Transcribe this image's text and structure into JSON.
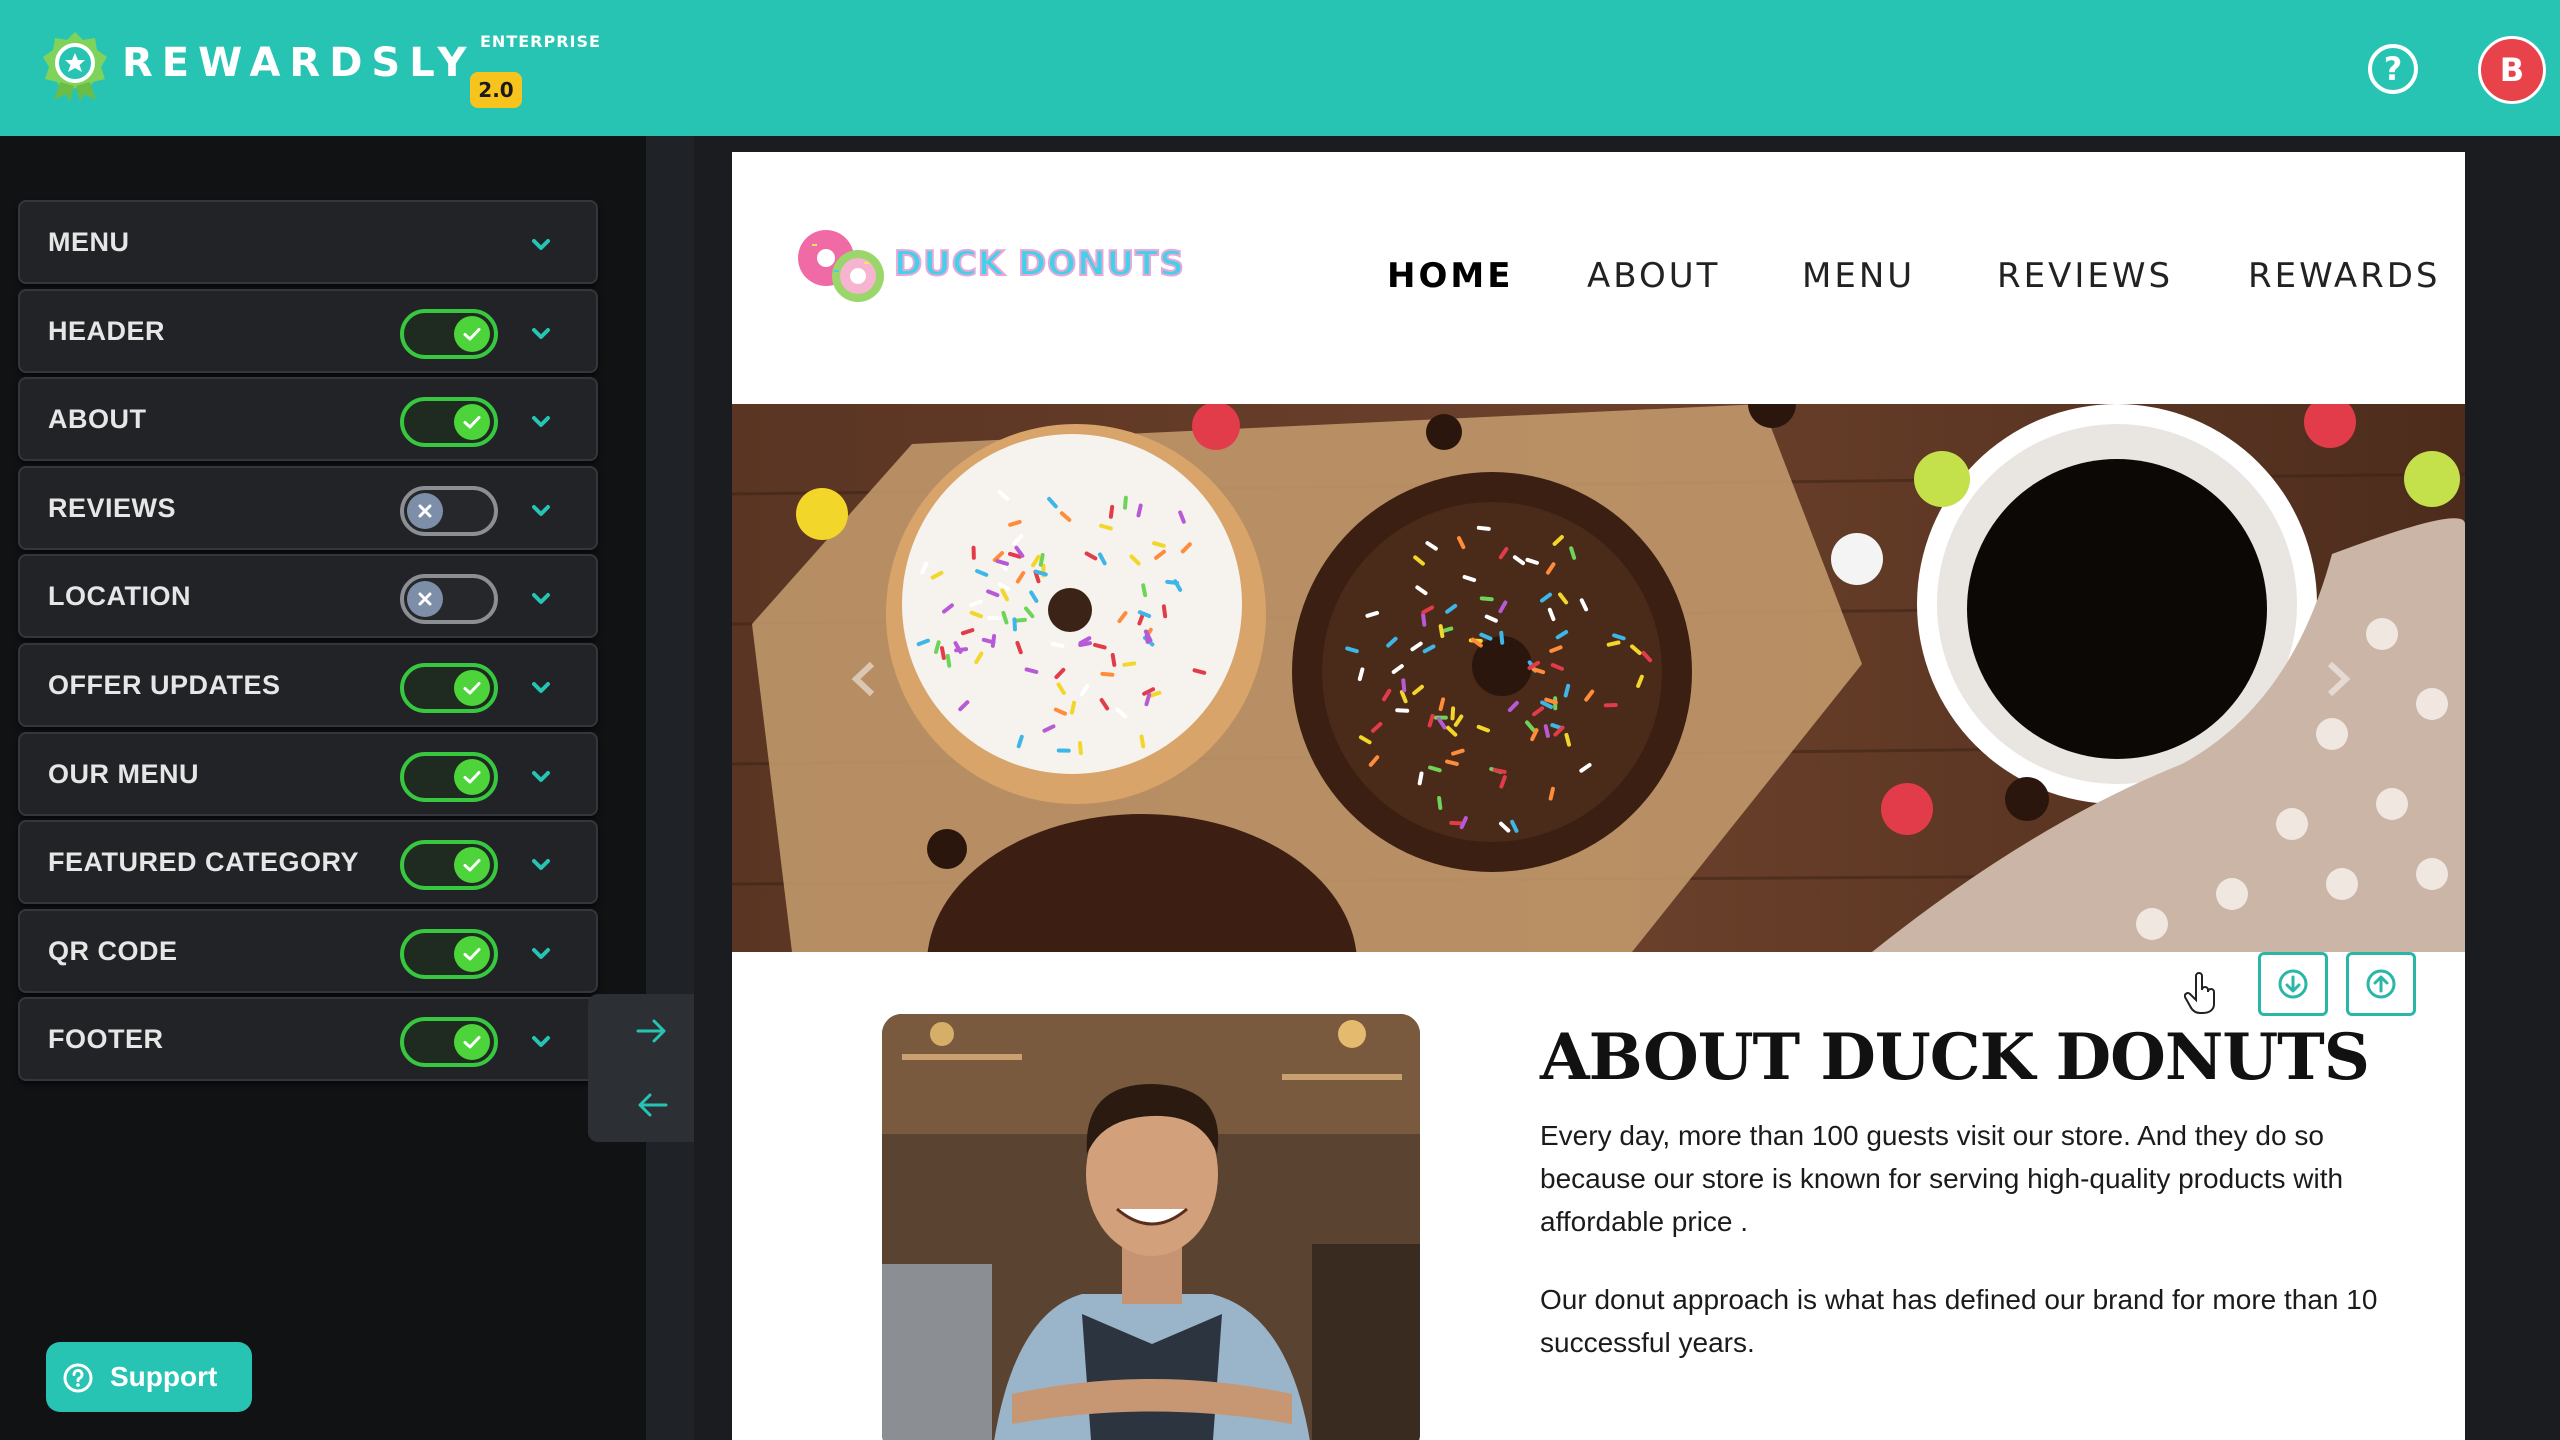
{
  "app": {
    "brand": "REWARDSLY",
    "edition": "ENTERPRISE",
    "version": "2.0",
    "help_label": "?",
    "avatar_initial": "B"
  },
  "sidebar": {
    "sections": [
      {
        "label": "MENU",
        "has_toggle": false
      },
      {
        "label": "HEADER",
        "has_toggle": true,
        "enabled": true
      },
      {
        "label": "ABOUT",
        "has_toggle": true,
        "enabled": true
      },
      {
        "label": "REVIEWS",
        "has_toggle": true,
        "enabled": false
      },
      {
        "label": "LOCATION",
        "has_toggle": true,
        "enabled": false
      },
      {
        "label": "OFFER UPDATES",
        "has_toggle": true,
        "enabled": true
      },
      {
        "label": "OUR MENU",
        "has_toggle": true,
        "enabled": true
      },
      {
        "label": "FEATURED CATEGORY",
        "has_toggle": true,
        "enabled": true
      },
      {
        "label": "QR CODE",
        "has_toggle": true,
        "enabled": true
      },
      {
        "label": "FOOTER",
        "has_toggle": true,
        "enabled": true
      }
    ],
    "support_label": "Support"
  },
  "preview": {
    "site_logo_text": "DUCK DONUTS",
    "nav": [
      "HOME",
      "ABOUT",
      "MENU",
      "REVIEWS",
      "REWARDS"
    ],
    "active_nav": "HOME",
    "about_title": "ABOUT DUCK DONUTS",
    "about_paragraph_1": "Every day, more than 100 guests visit our store. And they do so because our store is known for serving high-quality products with affordable price .",
    "about_paragraph_2": "Our donut approach is what has defined our brand for more than 10 successful years."
  },
  "colors": {
    "accent": "#27c4b4",
    "toggle_on": "#38c83f",
    "toggle_off": "#8b8e93",
    "avatar": "#e8424a",
    "version_badge": "#f7c41e"
  },
  "icons": {
    "help": "help-circle-icon",
    "chevron": "chevron-down-icon",
    "toggle_on": "check-icon",
    "toggle_off": "x-icon",
    "forward": "arrow-right-icon",
    "back": "arrow-left-icon",
    "move_down": "arrow-down-circle-icon",
    "move_up": "arrow-up-circle-icon"
  }
}
